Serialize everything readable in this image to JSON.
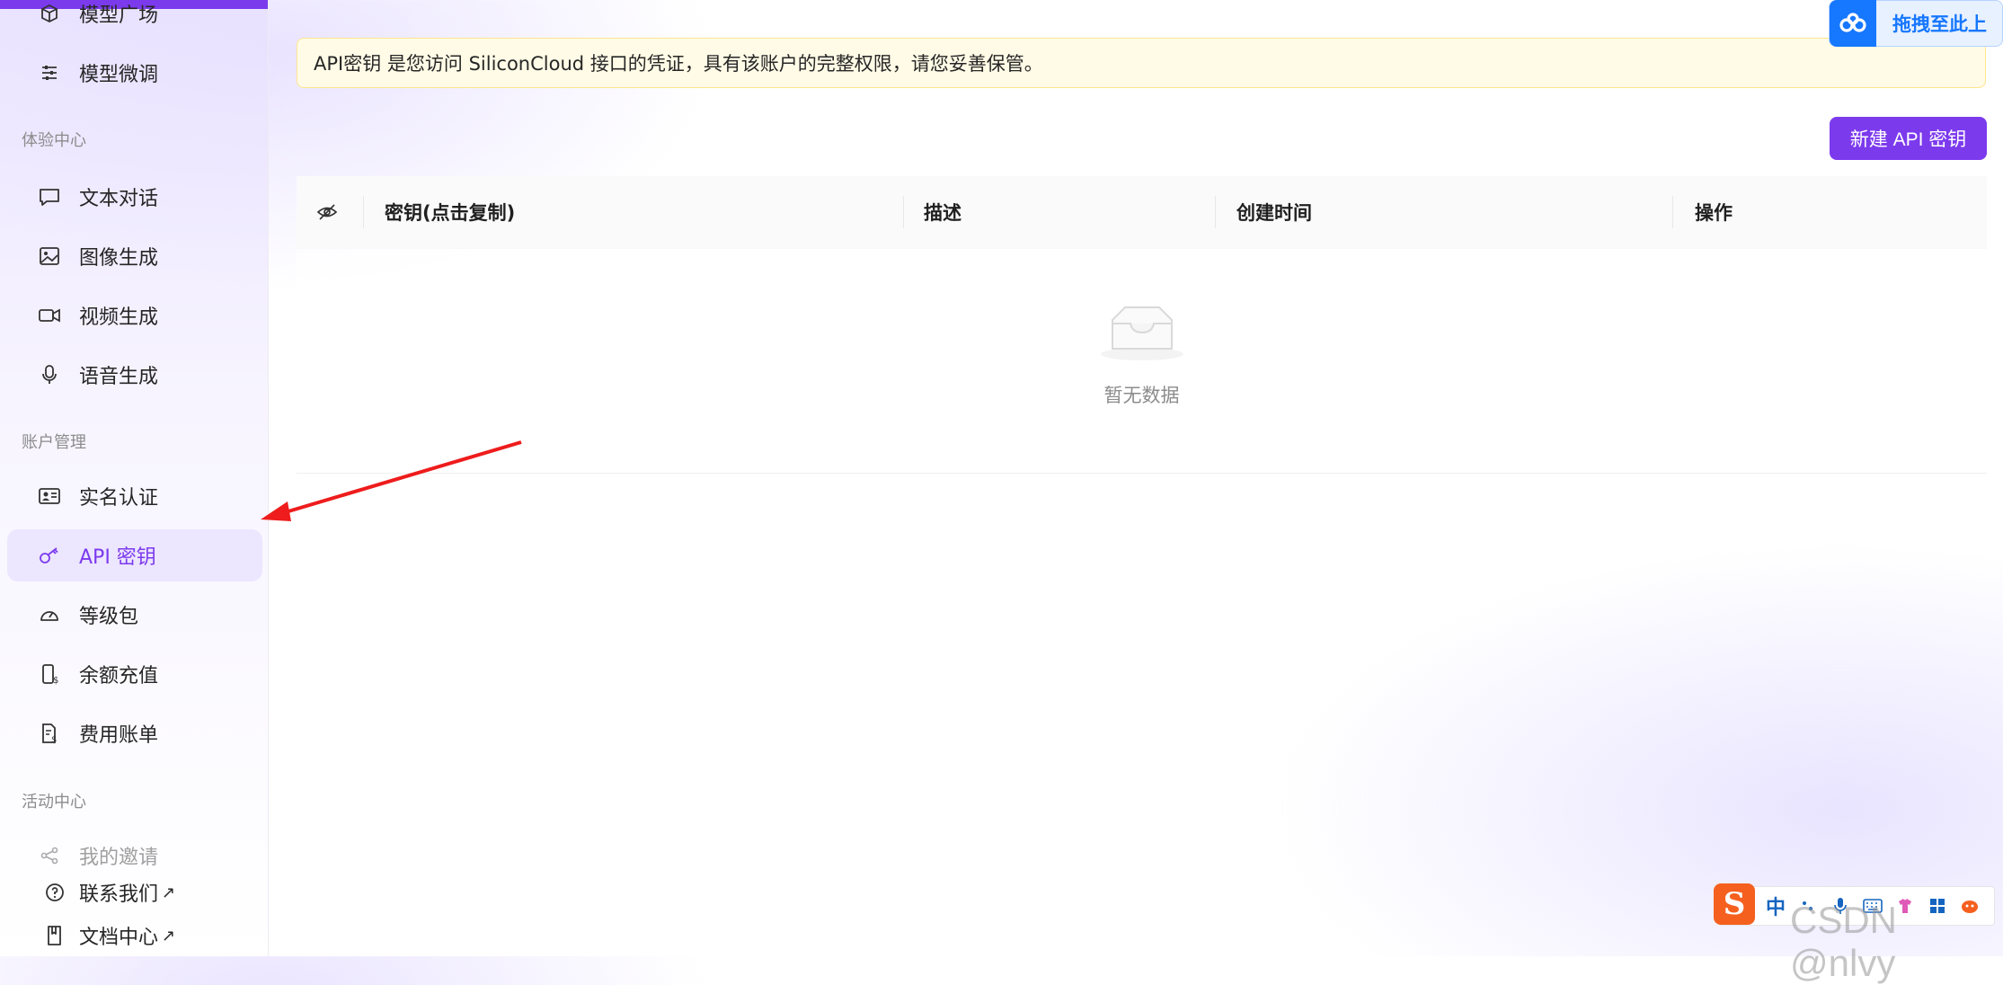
{
  "sidebar": {
    "items_top": [
      {
        "label": "模型广场"
      },
      {
        "label": "模型微调"
      }
    ],
    "section_experience": "体验中心",
    "items_experience": [
      {
        "label": "文本对话"
      },
      {
        "label": "图像生成"
      },
      {
        "label": "视频生成"
      },
      {
        "label": "语音生成"
      }
    ],
    "section_account": "账户管理",
    "items_account": [
      {
        "label": "实名认证"
      },
      {
        "label": "API 密钥"
      },
      {
        "label": "等级包"
      },
      {
        "label": "余额充值"
      },
      {
        "label": "费用账单"
      }
    ],
    "section_activity": "活动中心",
    "items_activity": [
      {
        "label": "我的邀请"
      }
    ],
    "footer": [
      {
        "label": "联系我们",
        "ext": "↗"
      },
      {
        "label": "文档中心",
        "ext": "↗"
      }
    ],
    "accent_color": "#7c3aed"
  },
  "notice": "API密钥 是您访问 SiliconCloud 接口的凭证，具有该账户的完整权限，请您妥善保管。",
  "upload_chip": "拖拽至此上",
  "new_button": "新建 API 密钥",
  "table": {
    "columns": [
      "密钥(点击复制)",
      "描述",
      "创建时间",
      "操作"
    ],
    "empty": "暂无数据"
  },
  "ime": {
    "lang": "中"
  },
  "watermark": "CSDN @nlvy"
}
